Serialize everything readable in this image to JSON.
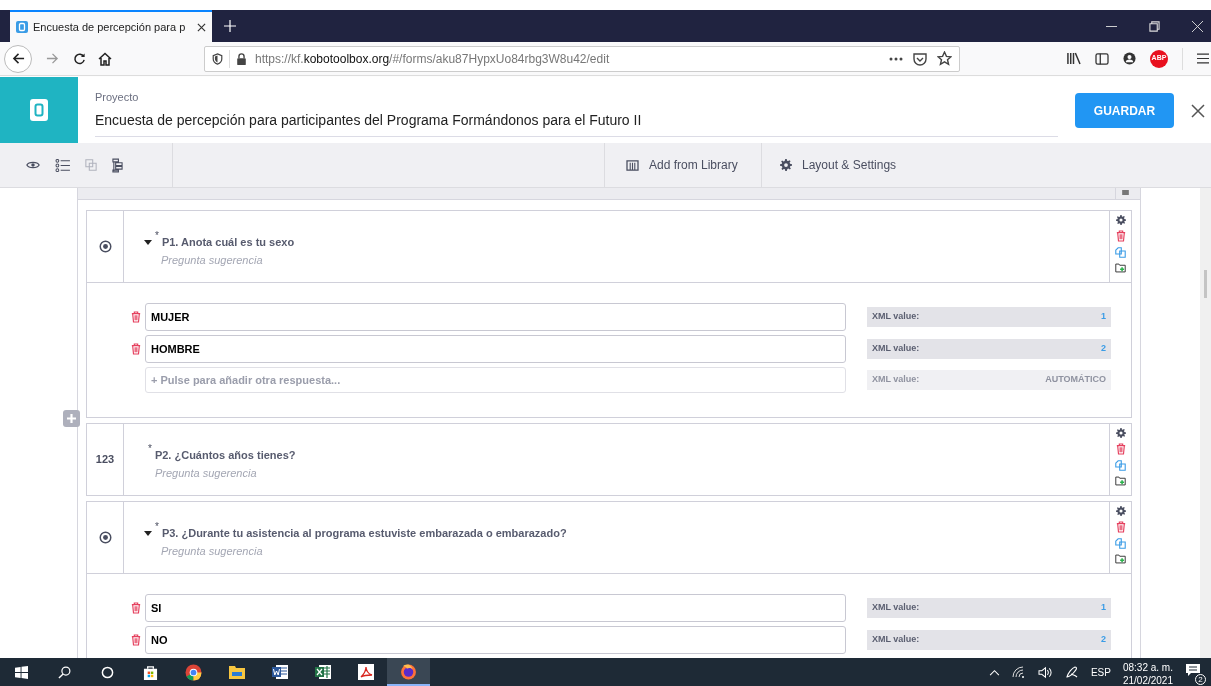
{
  "browser": {
    "tab_title": "Encuesta de percepción para p",
    "url": {
      "scheme": "https://kf.",
      "domain": "kobotoolbox.org",
      "path": "/#/forms/aku87HypxUo84rbg3W8u42/edit"
    },
    "adblock_label": "ABP"
  },
  "header": {
    "label": "Proyecto",
    "project_name": "Encuesta de percepción para participantes del Programa Formándonos para el Futuro II",
    "save_button": "GUARDAR"
  },
  "toolbar": {
    "library": "Add from Library",
    "settings": "Layout & Settings"
  },
  "questions": [
    {
      "kind": "select_one",
      "required_mark": "*",
      "title": "P1. Anota cuál es tu sexo",
      "hint": "Pregunta sugerencia",
      "options": [
        {
          "label": "MUJER",
          "xml_label": "XML value:",
          "xml_value": "1"
        },
        {
          "label": "HOMBRE",
          "xml_label": "XML value:",
          "xml_value": "2"
        }
      ],
      "add_option": {
        "placeholder": "+ Pulse para añadir otra respuesta...",
        "xml_label": "XML value:",
        "xml_value": "AUTOMÁTICO"
      }
    },
    {
      "kind": "integer",
      "type_label": "123",
      "required_mark": "*",
      "title": "P2. ¿Cuántos años tienes?",
      "hint": "Pregunta sugerencia"
    },
    {
      "kind": "select_one",
      "required_mark": "*",
      "title": "P3. ¿Durante tu asistencia al programa estuviste embarazada o embarazado?",
      "hint": "Pregunta sugerencia",
      "options": [
        {
          "label": "SI",
          "xml_label": "XML value:",
          "xml_value": "1"
        },
        {
          "label": "NO",
          "xml_label": "XML value:",
          "xml_value": "2"
        }
      ]
    }
  ],
  "taskbar": {
    "language": "ESP",
    "time": "08:32 a. m.",
    "date": "21/02/2021",
    "notifications": "2"
  }
}
